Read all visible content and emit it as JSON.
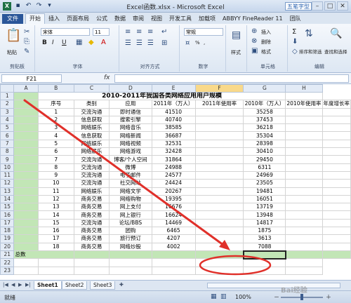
{
  "window": {
    "title": "Excel函数.xlsx - Microsoft Excel",
    "badge": "五笔字型",
    "minimize": "–",
    "restore": "□",
    "close": "✕"
  },
  "ribbon_tabs": [
    "文件",
    "开始",
    "插入",
    "页面布局",
    "公式",
    "数据",
    "审阅",
    "视图",
    "开发工具",
    "加载项",
    "ABBYY FineReader 11",
    "团队"
  ],
  "ribbon": {
    "paste_label": "粘贴",
    "clipboard_group": "剪贴板",
    "font_name": "宋体",
    "font_size": "11",
    "bold": "B",
    "italic": "I",
    "underline": "U",
    "font_group": "字体",
    "align_group": "对齐方式",
    "number_format": "常规",
    "percent": "%",
    "comma": ",",
    "number_group": "数字",
    "style_label": "样式",
    "insert_label": "插入",
    "delete_label": "删除",
    "format_label": "格式",
    "cells_group": "单元格",
    "sigma": "Σ",
    "sort_filter": "排序和筛选",
    "find_select": "查找和选择",
    "editing_group": "编辑"
  },
  "formula_bar": {
    "name_box": "F21",
    "fx": "fx",
    "content": ""
  },
  "columns": [
    "A",
    "B",
    "C",
    "D",
    "E",
    "F",
    "G",
    "H"
  ],
  "sheet": {
    "title": "2010-2011年我国各类网络应用用户规模",
    "headers": [
      "序号",
      "类别",
      "应用",
      "2011年（万人）",
      "2011年使用率",
      "2010年（万人）",
      "2010年使用率",
      "年度增长率"
    ],
    "rows": [
      [
        "1",
        "交流沟通",
        "即时通信",
        "41510",
        "",
        "35258",
        "",
        ""
      ],
      [
        "2",
        "信息获取",
        "搜索引擎",
        "40740",
        "",
        "37453",
        "",
        ""
      ],
      [
        "3",
        "网络娱乐",
        "网络音乐",
        "38585",
        "",
        "36218",
        "",
        ""
      ],
      [
        "4",
        "信息获取",
        "网络新闻",
        "36687",
        "",
        "35304",
        "",
        ""
      ],
      [
        "5",
        "网络娱乐",
        "网络视频",
        "32531",
        "",
        "28398",
        "",
        ""
      ],
      [
        "6",
        "网络娱乐",
        "网络游戏",
        "32428",
        "",
        "30410",
        "",
        ""
      ],
      [
        "7",
        "交流沟通",
        "博客/个人空间",
        "31864",
        "",
        "29450",
        "",
        ""
      ],
      [
        "8",
        "交流沟通",
        "微博",
        "24988",
        "",
        "6311",
        "",
        ""
      ],
      [
        "9",
        "交流沟通",
        "电子邮件",
        "24577",
        "",
        "24969",
        "",
        ""
      ],
      [
        "10",
        "交流沟通",
        "社交网站",
        "24424",
        "",
        "23505",
        "",
        ""
      ],
      [
        "11",
        "网络娱乐",
        "网络文学",
        "20267",
        "",
        "19481",
        "",
        ""
      ],
      [
        "12",
        "商务交易",
        "网络购物",
        "19395",
        "",
        "16051",
        "",
        ""
      ],
      [
        "13",
        "商务交易",
        "网上支付",
        "16676",
        "",
        "13719",
        "",
        ""
      ],
      [
        "14",
        "商务交易",
        "网上银行",
        "16624",
        "",
        "13948",
        "",
        ""
      ],
      [
        "15",
        "交流沟通",
        "论坛/BBS",
        "14469",
        "",
        "14817",
        "",
        ""
      ],
      [
        "16",
        "商务交易",
        "团购",
        "6465",
        "",
        "1875",
        "",
        ""
      ],
      [
        "17",
        "商务交易",
        "旅行预订",
        "4207",
        "",
        "3613",
        "",
        ""
      ],
      [
        "18",
        "商务交易",
        "网络炒股",
        "4002",
        "",
        "7088",
        "",
        ""
      ]
    ],
    "total_label": "总数",
    "row_numbers": [
      "1",
      "2",
      "3",
      "4",
      "5",
      "6",
      "7",
      "8",
      "9",
      "10",
      "11",
      "12",
      "13",
      "14",
      "15",
      "16",
      "17",
      "18",
      "19",
      "20",
      "21",
      "22",
      "23"
    ]
  },
  "sheet_tabs": [
    "Sheet1",
    "Sheet2",
    "Sheet3"
  ],
  "status": {
    "ready": "就绪",
    "zoom": "100%",
    "zoom_minus": "－",
    "zoom_plus": "＋"
  },
  "watermark": "Bai经验",
  "colors": {
    "body_fill": "#c2e6b6",
    "annotation": "#e0302a",
    "file_tab": "#2a5699"
  }
}
